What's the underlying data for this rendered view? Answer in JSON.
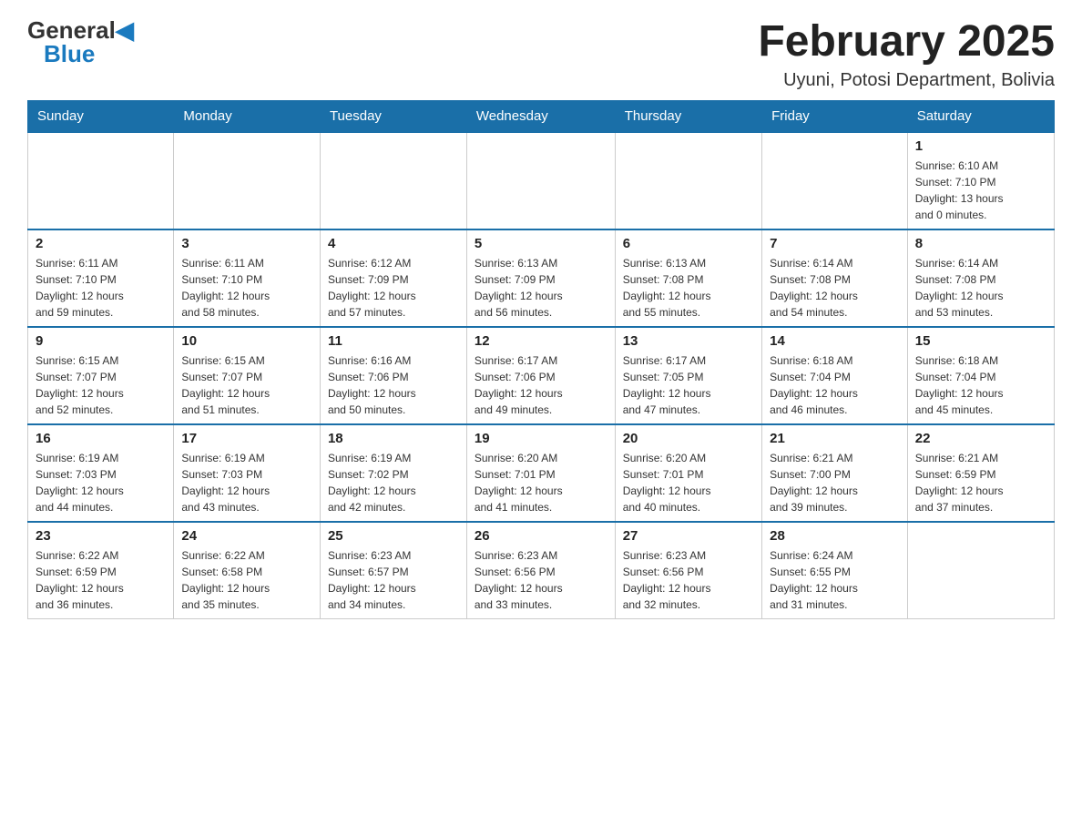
{
  "header": {
    "logo_general": "General",
    "logo_blue": "Blue",
    "month_title": "February 2025",
    "location": "Uyuni, Potosi Department, Bolivia"
  },
  "weekdays": [
    "Sunday",
    "Monday",
    "Tuesday",
    "Wednesday",
    "Thursday",
    "Friday",
    "Saturday"
  ],
  "weeks": [
    [
      {
        "day": "",
        "info": ""
      },
      {
        "day": "",
        "info": ""
      },
      {
        "day": "",
        "info": ""
      },
      {
        "day": "",
        "info": ""
      },
      {
        "day": "",
        "info": ""
      },
      {
        "day": "",
        "info": ""
      },
      {
        "day": "1",
        "info": "Sunrise: 6:10 AM\nSunset: 7:10 PM\nDaylight: 13 hours\nand 0 minutes."
      }
    ],
    [
      {
        "day": "2",
        "info": "Sunrise: 6:11 AM\nSunset: 7:10 PM\nDaylight: 12 hours\nand 59 minutes."
      },
      {
        "day": "3",
        "info": "Sunrise: 6:11 AM\nSunset: 7:10 PM\nDaylight: 12 hours\nand 58 minutes."
      },
      {
        "day": "4",
        "info": "Sunrise: 6:12 AM\nSunset: 7:09 PM\nDaylight: 12 hours\nand 57 minutes."
      },
      {
        "day": "5",
        "info": "Sunrise: 6:13 AM\nSunset: 7:09 PM\nDaylight: 12 hours\nand 56 minutes."
      },
      {
        "day": "6",
        "info": "Sunrise: 6:13 AM\nSunset: 7:08 PM\nDaylight: 12 hours\nand 55 minutes."
      },
      {
        "day": "7",
        "info": "Sunrise: 6:14 AM\nSunset: 7:08 PM\nDaylight: 12 hours\nand 54 minutes."
      },
      {
        "day": "8",
        "info": "Sunrise: 6:14 AM\nSunset: 7:08 PM\nDaylight: 12 hours\nand 53 minutes."
      }
    ],
    [
      {
        "day": "9",
        "info": "Sunrise: 6:15 AM\nSunset: 7:07 PM\nDaylight: 12 hours\nand 52 minutes."
      },
      {
        "day": "10",
        "info": "Sunrise: 6:15 AM\nSunset: 7:07 PM\nDaylight: 12 hours\nand 51 minutes."
      },
      {
        "day": "11",
        "info": "Sunrise: 6:16 AM\nSunset: 7:06 PM\nDaylight: 12 hours\nand 50 minutes."
      },
      {
        "day": "12",
        "info": "Sunrise: 6:17 AM\nSunset: 7:06 PM\nDaylight: 12 hours\nand 49 minutes."
      },
      {
        "day": "13",
        "info": "Sunrise: 6:17 AM\nSunset: 7:05 PM\nDaylight: 12 hours\nand 47 minutes."
      },
      {
        "day": "14",
        "info": "Sunrise: 6:18 AM\nSunset: 7:04 PM\nDaylight: 12 hours\nand 46 minutes."
      },
      {
        "day": "15",
        "info": "Sunrise: 6:18 AM\nSunset: 7:04 PM\nDaylight: 12 hours\nand 45 minutes."
      }
    ],
    [
      {
        "day": "16",
        "info": "Sunrise: 6:19 AM\nSunset: 7:03 PM\nDaylight: 12 hours\nand 44 minutes."
      },
      {
        "day": "17",
        "info": "Sunrise: 6:19 AM\nSunset: 7:03 PM\nDaylight: 12 hours\nand 43 minutes."
      },
      {
        "day": "18",
        "info": "Sunrise: 6:19 AM\nSunset: 7:02 PM\nDaylight: 12 hours\nand 42 minutes."
      },
      {
        "day": "19",
        "info": "Sunrise: 6:20 AM\nSunset: 7:01 PM\nDaylight: 12 hours\nand 41 minutes."
      },
      {
        "day": "20",
        "info": "Sunrise: 6:20 AM\nSunset: 7:01 PM\nDaylight: 12 hours\nand 40 minutes."
      },
      {
        "day": "21",
        "info": "Sunrise: 6:21 AM\nSunset: 7:00 PM\nDaylight: 12 hours\nand 39 minutes."
      },
      {
        "day": "22",
        "info": "Sunrise: 6:21 AM\nSunset: 6:59 PM\nDaylight: 12 hours\nand 37 minutes."
      }
    ],
    [
      {
        "day": "23",
        "info": "Sunrise: 6:22 AM\nSunset: 6:59 PM\nDaylight: 12 hours\nand 36 minutes."
      },
      {
        "day": "24",
        "info": "Sunrise: 6:22 AM\nSunset: 6:58 PM\nDaylight: 12 hours\nand 35 minutes."
      },
      {
        "day": "25",
        "info": "Sunrise: 6:23 AM\nSunset: 6:57 PM\nDaylight: 12 hours\nand 34 minutes."
      },
      {
        "day": "26",
        "info": "Sunrise: 6:23 AM\nSunset: 6:56 PM\nDaylight: 12 hours\nand 33 minutes."
      },
      {
        "day": "27",
        "info": "Sunrise: 6:23 AM\nSunset: 6:56 PM\nDaylight: 12 hours\nand 32 minutes."
      },
      {
        "day": "28",
        "info": "Sunrise: 6:24 AM\nSunset: 6:55 PM\nDaylight: 12 hours\nand 31 minutes."
      },
      {
        "day": "",
        "info": ""
      }
    ]
  ]
}
